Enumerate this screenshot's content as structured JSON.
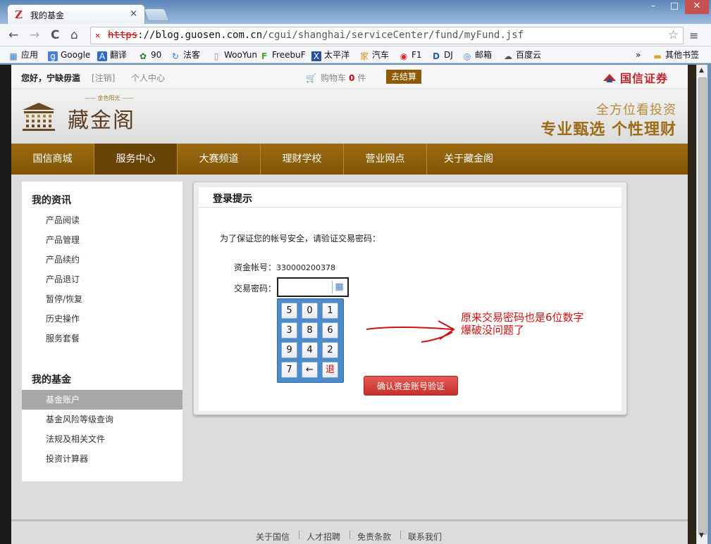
{
  "browser": {
    "tab_title": "我的基金",
    "tab_close": "×",
    "url_scheme": "https",
    "url_host": "://blog.guosen.com.cn",
    "url_path": "/cgui/shanghai/serviceCenter/fund/myFund.jsf",
    "nav": {
      "back": "←",
      "forward": "→",
      "reload": "C",
      "home": "⌂"
    },
    "star": "☆",
    "menu": "≡",
    "window_controls": {
      "minimize": "–",
      "restore": "□",
      "close": "✕"
    },
    "bookmarks": [
      "应用",
      "Google",
      "翻译",
      "90",
      "法客",
      "WooYun",
      "FreebuF",
      "太平洋",
      "汽车",
      "F1",
      "DJ",
      "邮箱",
      "百度云"
    ],
    "bookmark_overflow": "»",
    "other_bookmarks": "其他书签"
  },
  "topbar": {
    "greeting": "您好，宁缺毋滥",
    "logout": "[注销]",
    "personal_center": "个人中心",
    "cart_label": "购物车",
    "cart_count": "0",
    "cart_unit": "件",
    "checkout": "去结算",
    "brand": "国信证券"
  },
  "header": {
    "logo_text": "藏金阁",
    "logo_sub": "—— 金色阳光 ——",
    "tagline_1": "全方位看投资",
    "tagline_2": "专业甄选 个性理财"
  },
  "mainnav": [
    "国信商城",
    "服务中心",
    "大赛频道",
    "理财学校",
    "营业网点",
    "关于藏金阁"
  ],
  "mainnav_active": "服务中心",
  "sidebar": {
    "section1_title": "我的资讯",
    "section1_items": [
      "产品阅读",
      "产品管理",
      "产品续约",
      "产品退订",
      "暂停/恢复",
      "历史操作",
      "服务套餐"
    ],
    "section2_title": "我的基金",
    "section2_items": [
      "基金账户",
      "基金风险等级查询",
      "法规及相关文件",
      "投资计算器"
    ],
    "selected": "基金账户"
  },
  "login": {
    "title": "登录提示",
    "message": "为了保证您的帐号安全，请验证交易密码：",
    "account_label": "资金帐号：",
    "account_value": "330000200378",
    "password_label": "交易密码：",
    "password_value": "",
    "keypad_icon": "keyboard-icon",
    "keypad_keys": [
      "5",
      "0",
      "1",
      "3",
      "8",
      "6",
      "9",
      "4",
      "2",
      "7",
      "←",
      "退"
    ],
    "confirm_button": "确认资金账号验证"
  },
  "annotation": {
    "line1": "原来交易密码也是6位数字",
    "line2": "爆破没问题了",
    "color": "#d21010"
  },
  "footer": [
    "关于国信",
    "人才招聘",
    "免责条款",
    "联系我们"
  ],
  "colors": {
    "nav_brown": "#8d5f0b",
    "checkout_bg": "#8d5a00",
    "confirm_red": "#d7423e",
    "keypad_blue": "#4d8ccc"
  }
}
